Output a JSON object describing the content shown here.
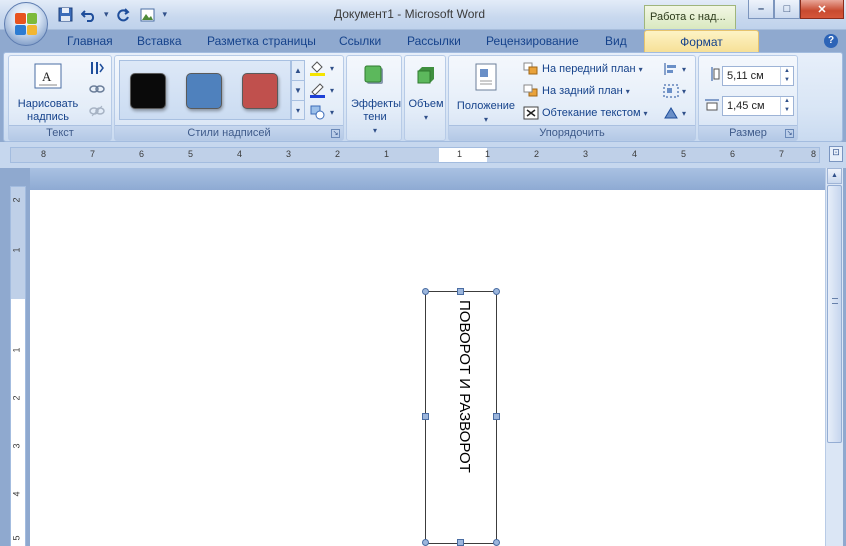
{
  "window": {
    "title": "Документ1 - Microsoft Word",
    "context_tab_title": "Работа с над...",
    "min_label": "–",
    "max_label": "□",
    "close_label": "✕"
  },
  "qat": {
    "save_icon": "save-icon",
    "undo_icon": "undo-icon",
    "redo_icon": "redo-icon",
    "picture_icon": "picture-icon"
  },
  "tabs": [
    {
      "label": "Главная"
    },
    {
      "label": "Вставка"
    },
    {
      "label": "Разметка страницы"
    },
    {
      "label": "Ссылки"
    },
    {
      "label": "Рассылки"
    },
    {
      "label": "Рецензирование"
    },
    {
      "label": "Вид"
    },
    {
      "label": "Формат",
      "active": true
    }
  ],
  "ribbon": {
    "text_group": {
      "label": "Текст",
      "draw_textbox": "Нарисовать надпись"
    },
    "styles_group": {
      "label": "Стили надписей",
      "swatches": [
        "#0a0a0a",
        "#4f81bd",
        "#c0504d"
      ]
    },
    "shadow_group": {
      "label": "Эффекты тени"
    },
    "volume_group": {
      "label": "Объем"
    },
    "arrange_group": {
      "label": "Упорядочить",
      "position": "Положение",
      "bring_front": "На передний план",
      "send_back": "На задний план",
      "wrap_text": "Обтекание текстом"
    },
    "size_group": {
      "label": "Размер",
      "height": "5,11 см",
      "width": "1,45 см"
    }
  },
  "ruler": {
    "labels": [
      "8",
      "7",
      "6",
      "5",
      "4",
      "3",
      "2",
      "1",
      "1",
      "1",
      "2",
      "3",
      "4",
      "5",
      "6",
      "7",
      "8"
    ],
    "v_labels": [
      "2",
      "1",
      "1",
      "2",
      "3",
      "4",
      "5"
    ]
  },
  "document": {
    "textbox_text": "ПОВОРОТ И РАЗВОРОТ"
  }
}
